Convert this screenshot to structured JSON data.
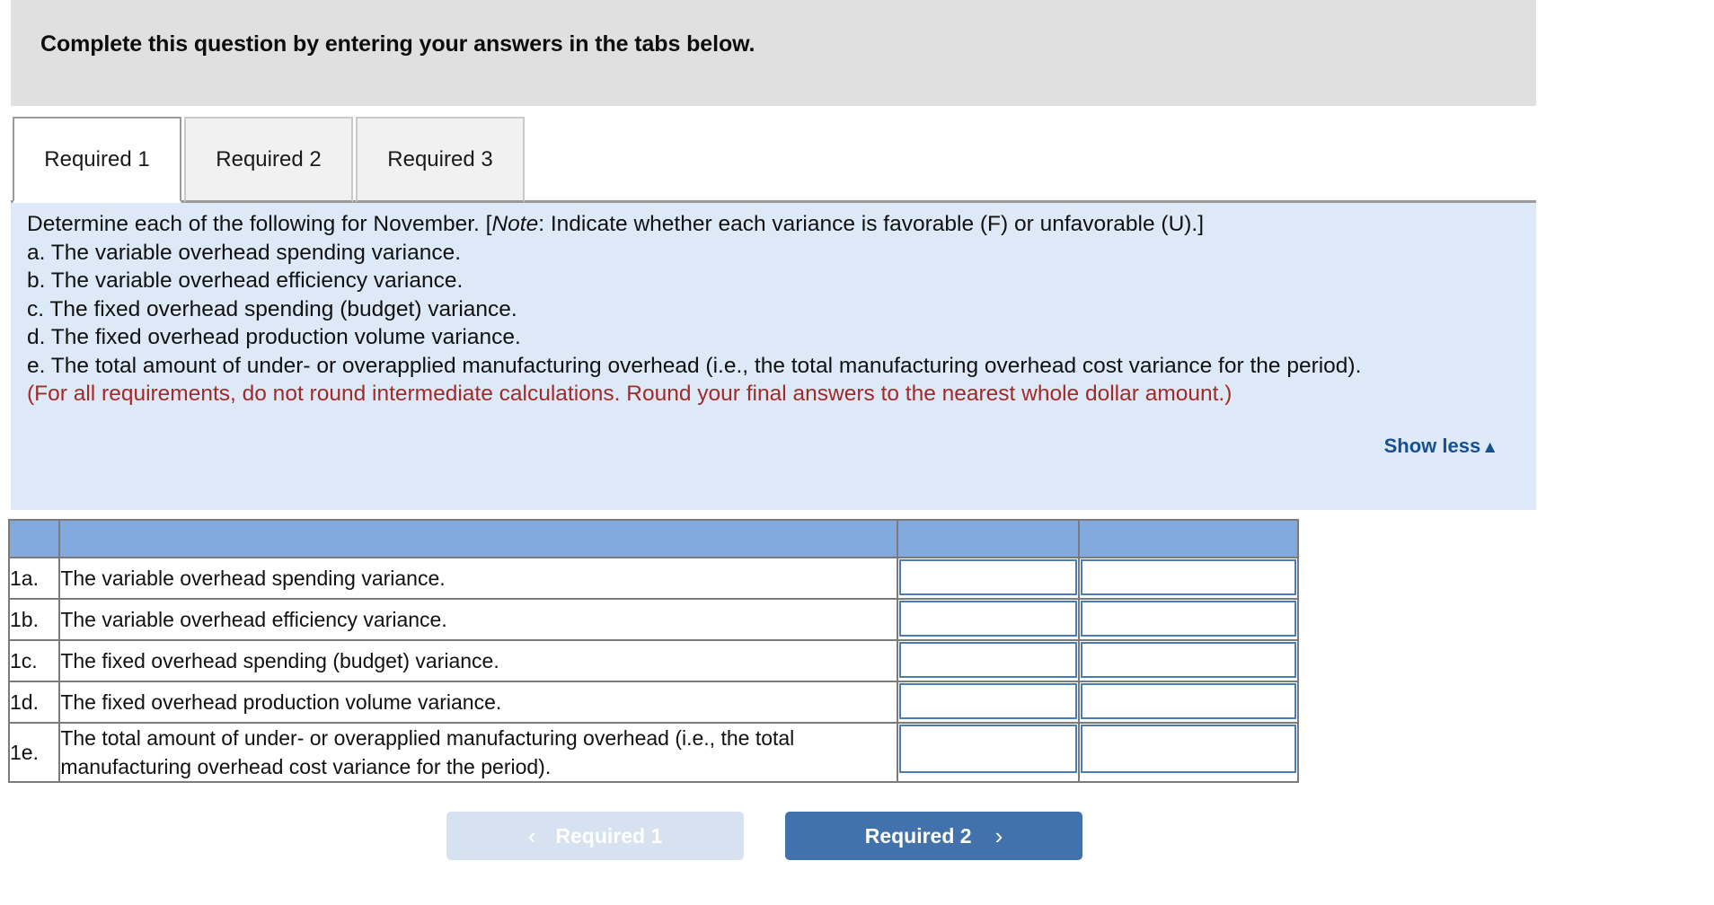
{
  "banner": {
    "title": "Complete this question by entering your answers in the tabs below."
  },
  "tabs": [
    {
      "label": "Required 1",
      "active": true
    },
    {
      "label": "Required 2",
      "active": false
    },
    {
      "label": "Required 3",
      "active": false
    }
  ],
  "instructions": {
    "intro_before_note": "Determine each of the following for November. [",
    "note_word": "Note",
    "intro_after_note": ": Indicate whether each variance is favorable (F) or unfavorable (U).]",
    "items": [
      "a. The variable overhead spending variance.",
      "b. The variable overhead efficiency variance.",
      "c. The fixed overhead spending (budget) variance.",
      "d. The fixed overhead production volume variance.",
      "e. The total amount of under- or overapplied manufacturing overhead (i.e., the total manufacturing overhead cost variance for the period)."
    ],
    "rounding_note": "(For all requirements, do not round intermediate calculations. Round your final answers to the nearest whole dollar amount.)",
    "show_less_label": "Show less",
    "show_less_caret": "▲"
  },
  "answer_table": {
    "headers": [
      "",
      "",
      "",
      ""
    ],
    "rows": [
      {
        "index": "1a.",
        "description": "The variable overhead spending variance.",
        "amount_value": "",
        "fu_value": "",
        "tall": false
      },
      {
        "index": "1b.",
        "description": "The variable overhead efficiency variance.",
        "amount_value": "",
        "fu_value": "",
        "tall": false
      },
      {
        "index": "1c.",
        "description": "The fixed overhead spending (budget) variance.",
        "amount_value": "",
        "fu_value": "",
        "tall": false
      },
      {
        "index": "1d.",
        "description": "The fixed overhead production volume variance.",
        "amount_value": "",
        "fu_value": "",
        "tall": false
      },
      {
        "index": "1e.",
        "description": "The total amount of under- or overapplied manufacturing overhead (i.e., the total manufacturing overhead cost variance for the period).",
        "amount_value": "",
        "fu_value": "",
        "tall": true
      }
    ]
  },
  "nav": {
    "prev_label": "Required 1",
    "prev_chevron": "‹",
    "next_label": "Required 2",
    "next_chevron": "›"
  },
  "colors": {
    "banner_bg": "#e0e0e0",
    "panel_bg": "#dde9f7",
    "table_header_bg": "#83aadf",
    "input_border": "#4a7cb5",
    "link_blue": "#17508f",
    "warning_red": "#a32a26",
    "next_button_bg": "#4272ab",
    "prev_button_bg": "#d6e2f0"
  }
}
